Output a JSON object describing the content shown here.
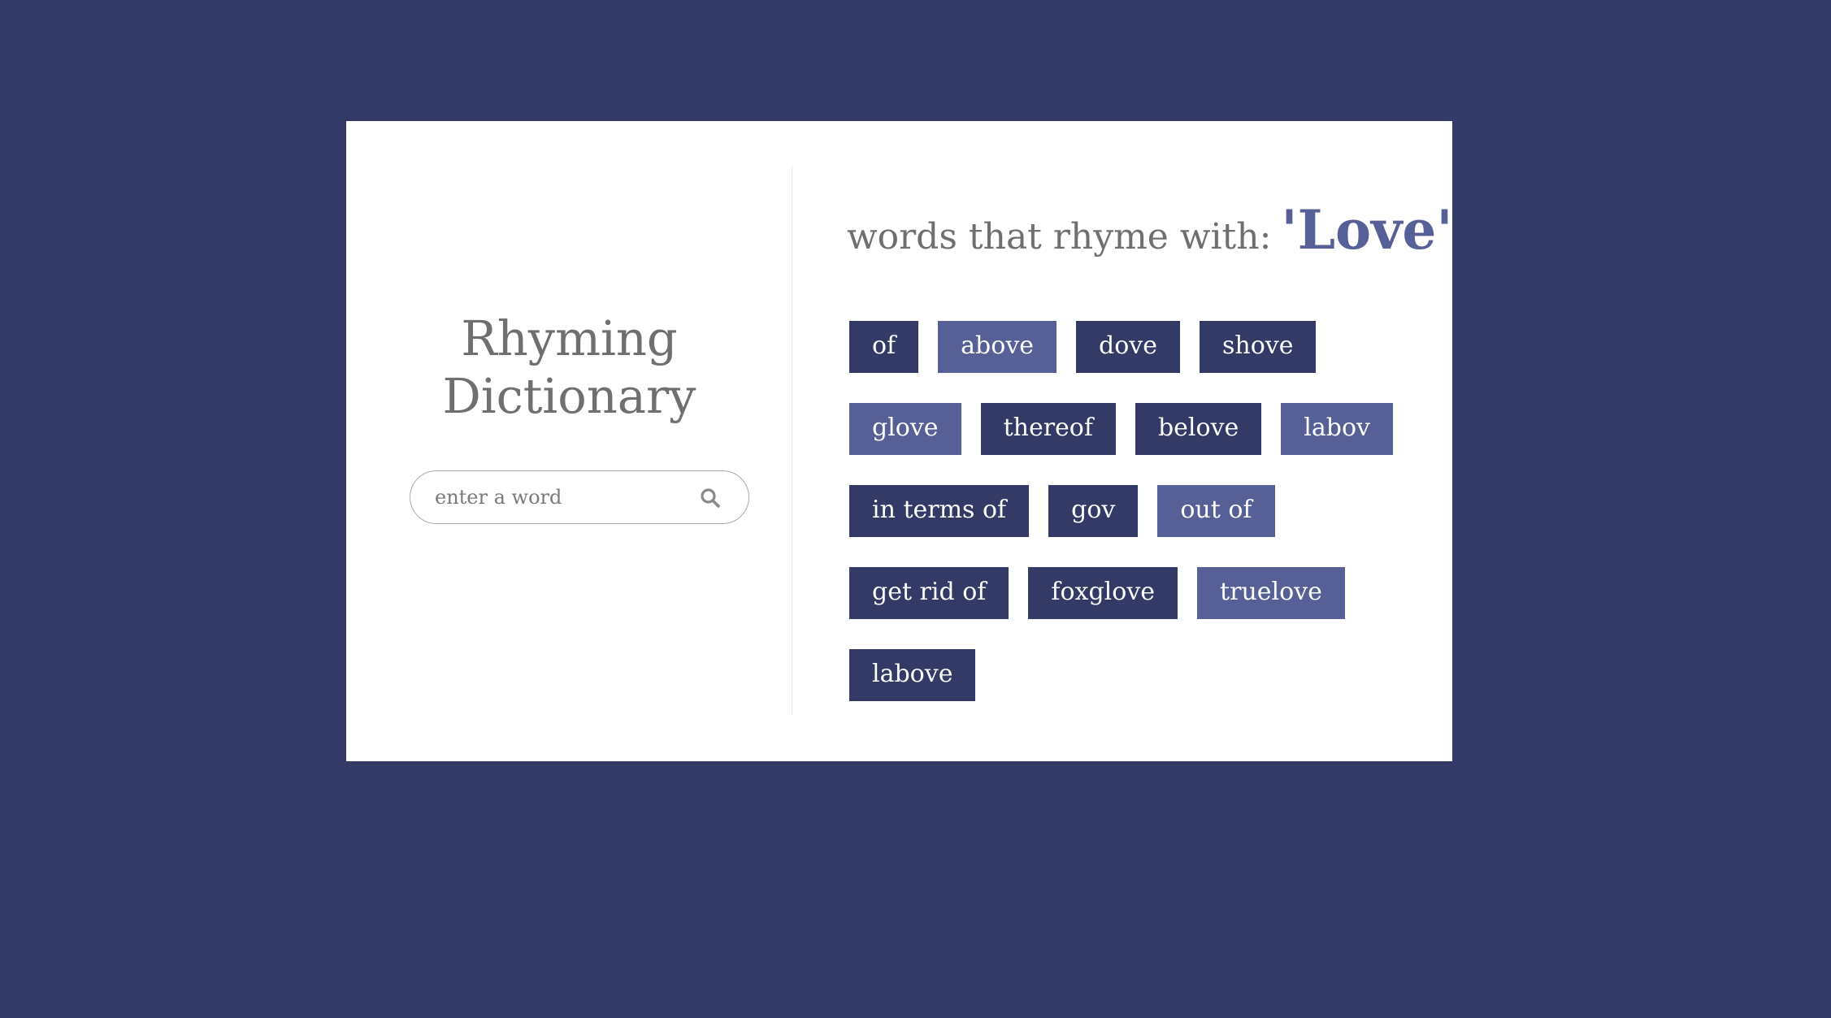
{
  "app": {
    "title_line1": "Rhyming",
    "title_line2": "Dictionary"
  },
  "search": {
    "placeholder": "enter a word",
    "value": "",
    "icon": "search-icon"
  },
  "results": {
    "prefix": "words that rhyme with:",
    "query": "'Love'",
    "rows": [
      [
        {
          "word": "of",
          "style": "dark"
        },
        {
          "word": "above",
          "style": "light"
        },
        {
          "word": "dove",
          "style": "dark"
        },
        {
          "word": "shove",
          "style": "dark"
        }
      ],
      [
        {
          "word": "glove",
          "style": "light"
        },
        {
          "word": "thereof",
          "style": "dark"
        },
        {
          "word": "belove",
          "style": "dark"
        },
        {
          "word": "labov",
          "style": "light"
        }
      ],
      [
        {
          "word": "in terms of",
          "style": "dark"
        },
        {
          "word": "gov",
          "style": "dark"
        },
        {
          "word": "out of",
          "style": "light"
        }
      ],
      [
        {
          "word": "get rid of",
          "style": "dark"
        },
        {
          "word": "foxglove",
          "style": "dark"
        },
        {
          "word": "truelove",
          "style": "light"
        }
      ],
      [
        {
          "word": "labove",
          "style": "dark"
        }
      ]
    ]
  },
  "colors": {
    "background": "#323a65",
    "card": "#ffffff",
    "tag_dark": "#323a65",
    "tag_light": "#565f96",
    "title_text": "#6f6f6f",
    "accent": "#565f96"
  }
}
